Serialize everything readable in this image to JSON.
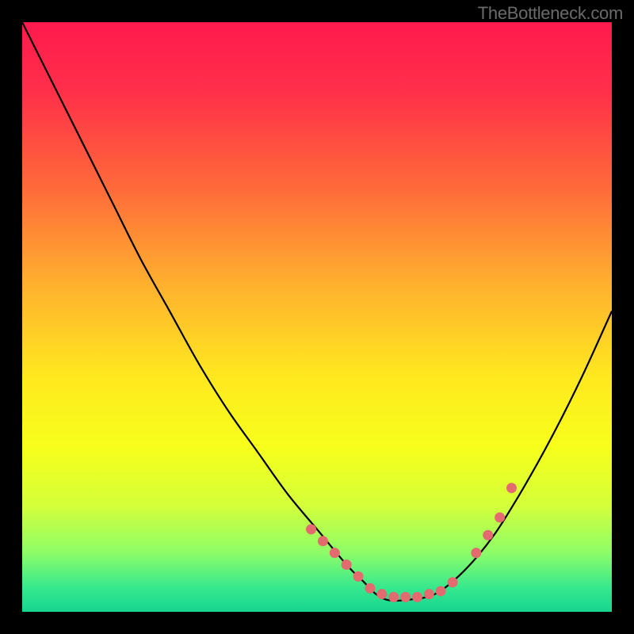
{
  "watermark": "TheBottleneck.com",
  "chart_data": {
    "type": "line",
    "title": "",
    "xlabel": "",
    "ylabel": "",
    "xlim": [
      0,
      100
    ],
    "ylim": [
      0,
      100
    ],
    "grid": false,
    "series": [
      {
        "name": "bottleneck-curve",
        "x": [
          0,
          5,
          10,
          15,
          20,
          25,
          30,
          35,
          40,
          45,
          50,
          55,
          58,
          60,
          62,
          65,
          70,
          75,
          80,
          85,
          90,
          95,
          100
        ],
        "y": [
          100,
          90,
          80,
          70,
          60,
          51,
          42,
          34,
          27,
          20,
          14,
          8,
          5,
          3,
          2,
          2,
          3,
          7,
          13,
          21,
          30,
          40,
          51
        ]
      }
    ],
    "markers": {
      "name": "highlight-dots",
      "x": [
        49,
        51,
        53,
        55,
        57,
        59,
        61,
        63,
        65,
        67,
        69,
        71,
        73,
        77,
        79,
        81,
        83
      ],
      "y": [
        14,
        12,
        10,
        8,
        6,
        4,
        3,
        2.5,
        2.5,
        2.5,
        3,
        3.5,
        5,
        10,
        13,
        16,
        21
      ]
    },
    "background": {
      "type": "vertical-gradient",
      "stops": [
        {
          "offset": 0.0,
          "color": "#ff1a4d"
        },
        {
          "offset": 0.12,
          "color": "#ff3049"
        },
        {
          "offset": 0.28,
          "color": "#ff6a3a"
        },
        {
          "offset": 0.45,
          "color": "#ffb22e"
        },
        {
          "offset": 0.6,
          "color": "#ffe81f"
        },
        {
          "offset": 0.72,
          "color": "#f7ff1a"
        },
        {
          "offset": 0.82,
          "color": "#d4ff3a"
        },
        {
          "offset": 0.9,
          "color": "#8dfd68"
        },
        {
          "offset": 0.96,
          "color": "#35e88e"
        },
        {
          "offset": 1.0,
          "color": "#17d48f"
        }
      ]
    }
  }
}
